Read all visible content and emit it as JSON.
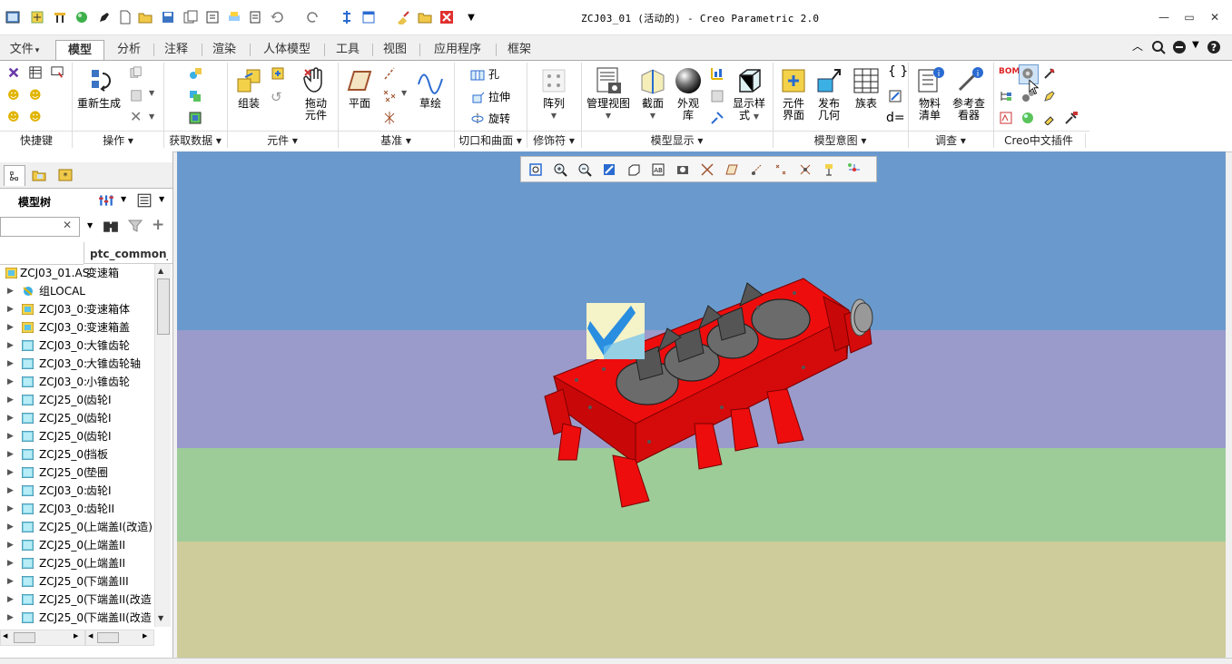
{
  "window": {
    "title": "ZCJ03_01 (活动的) - Creo Parametric 2.0",
    "controls": [
      "minimize-icon",
      "maximize-icon",
      "close-icon"
    ]
  },
  "quick_access": [
    "app-icon",
    "regenerate-icon",
    "tool-icon",
    "globe-icon",
    "pen-icon",
    "new-icon",
    "open-icon",
    "save-icon",
    "save-copy-icon",
    "copy-icon",
    "print-icon",
    "undo-icon",
    "redo-icon",
    "regen-icon",
    "windows-icon",
    "brush-icon",
    "folder-icon",
    "close-file-icon",
    "menu-down-icon"
  ],
  "tabs": [
    {
      "label": "文件",
      "arrow": "▾"
    },
    {
      "label": "模型",
      "active": true
    },
    {
      "label": "分析"
    },
    {
      "label": "注释"
    },
    {
      "label": "渲染"
    },
    {
      "label": "人体模型"
    },
    {
      "label": "工具"
    },
    {
      "label": "视图"
    },
    {
      "label": "应用程序"
    },
    {
      "label": "框架"
    }
  ],
  "ribbon": {
    "groups": [
      {
        "label": "快捷键"
      },
      {
        "label": "操作 ▾"
      },
      {
        "label": "获取数据 ▾"
      },
      {
        "label": "元件 ▾"
      },
      {
        "label": "基准 ▾"
      },
      {
        "label": "切口和曲面 ▾"
      },
      {
        "label": "修饰符 ▾"
      },
      {
        "label": "模型显示 ▾"
      },
      {
        "label": "模型意图 ▾"
      },
      {
        "label": "调查 ▾"
      },
      {
        "label": "Creo中文插件"
      }
    ],
    "buttons": {
      "regenerate": "重新生成",
      "assemble": "组装",
      "drag_line1": "拖动",
      "drag_line2": "元件",
      "plane": "平面",
      "sketch": "草绘",
      "hole": "孔",
      "extrude": "拉伸",
      "revolve": "旋转",
      "pattern": "阵列",
      "manage_views": "管理视图",
      "section": "截面",
      "appearance_line1": "外观",
      "appearance_line2": "库",
      "display_style_line1": "显示样",
      "display_style_line2": "式",
      "component_interface_line1": "元件",
      "component_interface_line2": "界面",
      "publish_geometry_line1": "发布",
      "publish_geometry_line2": "几何",
      "family_table": "族表",
      "bom_line1": "物料",
      "bom_line2": "清单",
      "reference_viewer_line1": "参考查",
      "reference_viewer_line2": "看器",
      "relations": "d=",
      "bom_tag": "BOM"
    }
  },
  "left_panel": {
    "tabs": [
      "model-tree-tab-icon",
      "folder-browser-tab-icon",
      "favorites-tab-icon"
    ],
    "header": "模型树",
    "search_value": "",
    "column_header": "ptc_common_n",
    "root": {
      "name": "ZCJ03_01.AS",
      "comment": "变速箱"
    },
    "items": [
      {
        "name": "组LOCAL",
        "comment": "",
        "type": "group"
      },
      {
        "name": "ZCJ03_0:",
        "comment": "变速箱体",
        "type": "asm"
      },
      {
        "name": "ZCJ03_0:",
        "comment": "变速箱盖",
        "type": "asm"
      },
      {
        "name": "ZCJ03_0:",
        "comment": "大锥齿轮",
        "type": "part"
      },
      {
        "name": "ZCJ03_0:",
        "comment": "大锥齿轮轴",
        "type": "part"
      },
      {
        "name": "ZCJ03_0:",
        "comment": "小锥齿轮",
        "type": "part"
      },
      {
        "name": "ZCJ25_0(",
        "comment": "齿轮I",
        "type": "part"
      },
      {
        "name": "ZCJ25_0(",
        "comment": "齿轮I",
        "type": "part"
      },
      {
        "name": "ZCJ25_0(",
        "comment": "齿轮I",
        "type": "part"
      },
      {
        "name": "ZCJ25_0(",
        "comment": "挡板",
        "type": "part"
      },
      {
        "name": "ZCJ25_0(",
        "comment": "垫圈",
        "type": "part"
      },
      {
        "name": "ZCJ03_0:",
        "comment": "齿轮I",
        "type": "part"
      },
      {
        "name": "ZCJ03_0:",
        "comment": "齿轮II",
        "type": "part"
      },
      {
        "name": "ZCJ25_0(",
        "comment": "上端盖I(改造)",
        "type": "part"
      },
      {
        "name": "ZCJ25_0(",
        "comment": "上端盖II",
        "type": "part"
      },
      {
        "name": "ZCJ25_0(",
        "comment": "上端盖II",
        "type": "part"
      },
      {
        "name": "ZCJ25_0(",
        "comment": "下端盖III",
        "type": "part"
      },
      {
        "name": "ZCJ25_0(",
        "comment": "下端盖II(改造",
        "type": "part"
      },
      {
        "name": "ZCJ25_0(",
        "comment": "下端盖II(改造",
        "type": "part"
      }
    ]
  },
  "viewport": {
    "bands": [
      "#6a9acd",
      "#9a9bcb",
      "#9dcc99",
      "#cdcc9a"
    ],
    "model_color": "#ee0d0d",
    "toolbar": [
      "refit-icon",
      "zoom-in-icon",
      "zoom-out-icon",
      "repaint-icon",
      "saved-orientation-icon",
      "view-manager-icon",
      "display-style-icon",
      "datum-display-icon",
      "plane-display-icon",
      "axis-display-icon",
      "point-display-icon",
      "csys-display-icon",
      "annotation-display-icon",
      "spin-center-icon"
    ]
  },
  "colors": {
    "accent": "#1f6fc1",
    "tab_active_bg": "#ffffff",
    "panel_bg": "#f0f0f0"
  }
}
